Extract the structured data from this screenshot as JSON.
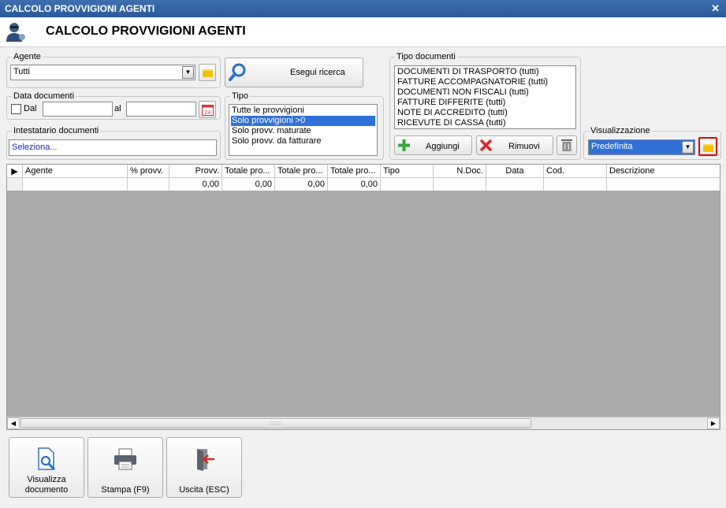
{
  "window": {
    "title": "CALCOLO PROVVIGIONI AGENTI"
  },
  "header": {
    "title": "CALCOLO PROVVIGIONI AGENTI"
  },
  "agente": {
    "legend": "Agente",
    "value": "Tutti"
  },
  "search": {
    "label": "Esegui ricerca"
  },
  "data_documenti": {
    "legend": "Data documenti",
    "dal_label": "Dal",
    "al_label": "al",
    "dal_value": "",
    "al_value": ""
  },
  "intestatario": {
    "legend": "Intestatario documenti",
    "value": "Seleziona..."
  },
  "tipo": {
    "legend": "Tipo",
    "options": [
      "Tutte le provvigioni",
      "Solo provvigioni >0",
      "Solo provv. maturate",
      "Solo provv. da fatturare"
    ],
    "selected_index": 1
  },
  "tipo_documenti": {
    "legend": "Tipo documenti",
    "items": [
      "DOCUMENTI DI TRASPORTO (tutti)",
      "FATTURE ACCOMPAGNATORIE (tutti)",
      "DOCUMENTI NON FISCALI (tutti)",
      "FATTURE DIFFERITE (tutti)",
      "NOTE DI ACCREDITO (tutti)",
      "RICEVUTE DI CASSA (tutti)"
    ],
    "add_label": "Aggiungi",
    "remove_label": "Rimuovi"
  },
  "visualizzazione": {
    "legend": "Visualizzazione",
    "value": "Predefinita"
  },
  "grid": {
    "columns": [
      "Agente",
      "% provv.",
      "Provv.",
      "Totale pro...",
      "Totale pro...",
      "Totale pro...",
      "Tipo",
      "N.Doc.",
      "Data",
      "Cod.",
      "Descrizione"
    ],
    "row": [
      "",
      "",
      "0,00",
      "0,00",
      "0,00",
      "0,00",
      "",
      "",
      "",
      "",
      ""
    ],
    "scroll_grip": "::::::::"
  },
  "footer": {
    "view_label_1": "Visualizza",
    "view_label_2": "documento",
    "print_label": "Stampa (F9)",
    "exit_label": "Uscita (ESC)"
  },
  "colors": {
    "title_bar": "#2b5898",
    "selection": "#3071d8",
    "highlight_border": "#e00000",
    "grid_empty": "#ababab"
  }
}
